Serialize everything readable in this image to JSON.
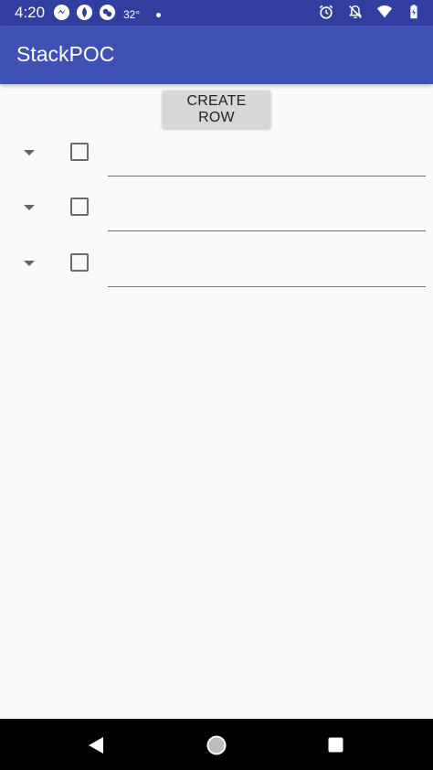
{
  "status_bar": {
    "time": "4:20",
    "temperature": "32°",
    "left_icons": [
      "messenger-icon",
      "app-icon",
      "weather-icon"
    ],
    "right_icons": [
      "alarm-icon",
      "notifications-off-icon",
      "wifi-icon",
      "battery-icon"
    ]
  },
  "app_bar": {
    "title": "StackPOC",
    "color": "#3f51b5",
    "status_color": "#303f9f"
  },
  "toolbar": {
    "create_row_label": "CREATE ROW"
  },
  "rows": [
    {
      "checked": false,
      "text": ""
    },
    {
      "checked": false,
      "text": ""
    },
    {
      "checked": false,
      "text": ""
    }
  ],
  "nav_bar": {
    "buttons": [
      "back-icon",
      "home-icon",
      "recents-icon"
    ]
  }
}
